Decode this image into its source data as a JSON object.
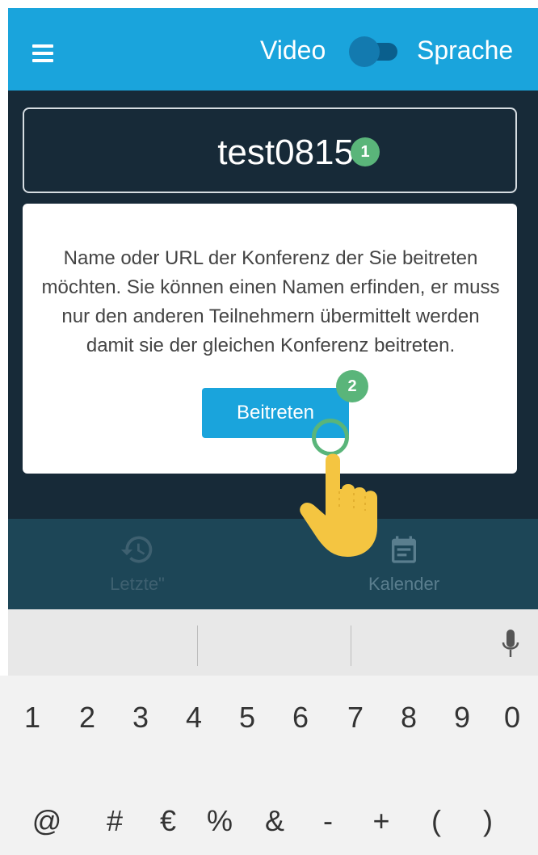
{
  "app_bar": {
    "video_label": "Video",
    "language_label": "Sprache"
  },
  "room": {
    "name": "test0815"
  },
  "info": {
    "text": "Name oder URL der Konferenz der Sie beitreten möchten. Sie können einen Namen erfinden, er muss nur den anderen Teilnehmern übermittelt werden damit sie der gleichen Konferenz beitreten."
  },
  "join_button_label": "Beitreten",
  "annotations": {
    "step1": "1",
    "step2": "2"
  },
  "bottom_nav": {
    "recent_label": "Letzte\"",
    "calendar_label": "Kalender"
  },
  "keyboard": {
    "row1": [
      "1",
      "2",
      "3",
      "4",
      "5",
      "6",
      "7",
      "8",
      "9",
      "0"
    ],
    "row2": [
      "@",
      "#",
      "€",
      "%",
      "&",
      "-",
      "+",
      "(",
      ")"
    ]
  },
  "colors": {
    "app_bar": "#1aa4dc",
    "dark_bg": "#172a38",
    "bottom_nav": "#1d4657",
    "annotation_green": "#5ab57a"
  }
}
